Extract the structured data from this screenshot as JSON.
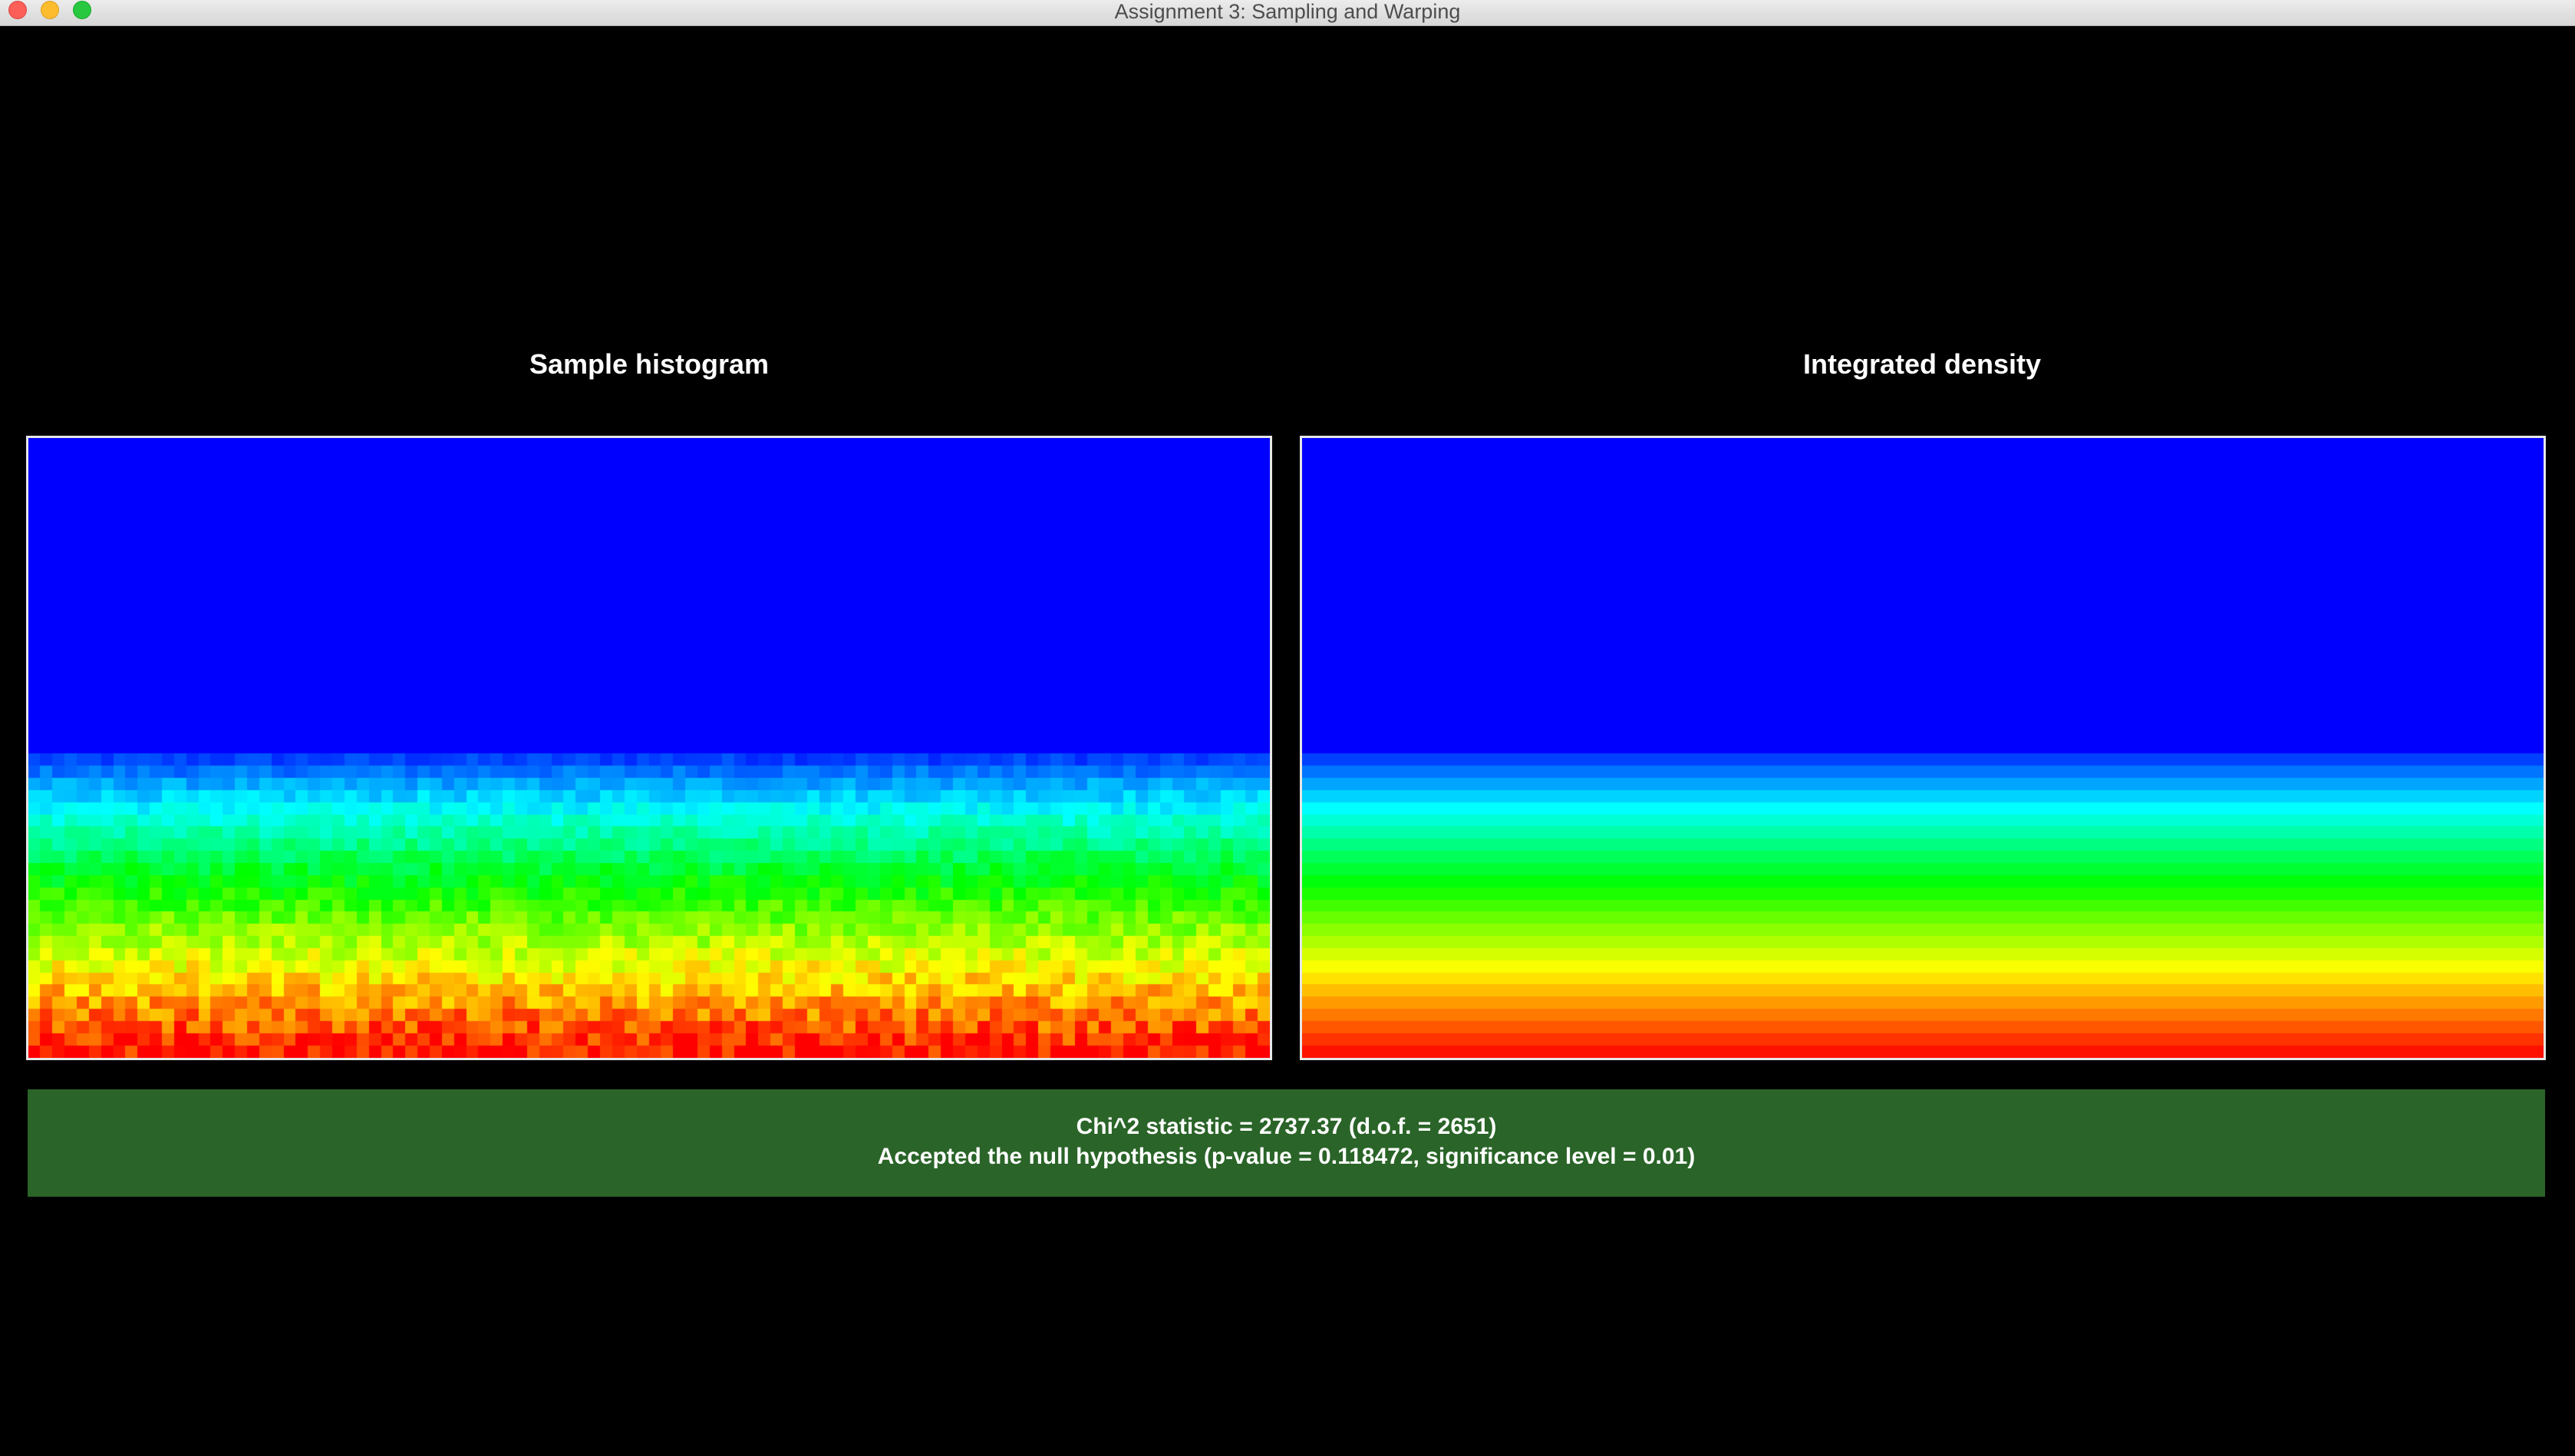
{
  "window": {
    "title": "Assignment 3: Sampling and Warping"
  },
  "panels": {
    "left": {
      "title": "Sample histogram"
    },
    "right": {
      "title": "Integrated density"
    }
  },
  "result": {
    "line1": "Chi^2 statistic = 2737.37 (d.o.f. = 2651)",
    "line2": "Accepted the null hypothesis (p-value = 0.118472, significance level = 0.01)"
  },
  "colors": {
    "background": "#000000",
    "result_bar": "#2a6428",
    "colormap_low": "#0000ff",
    "colormap_high": "#ff0000"
  }
}
